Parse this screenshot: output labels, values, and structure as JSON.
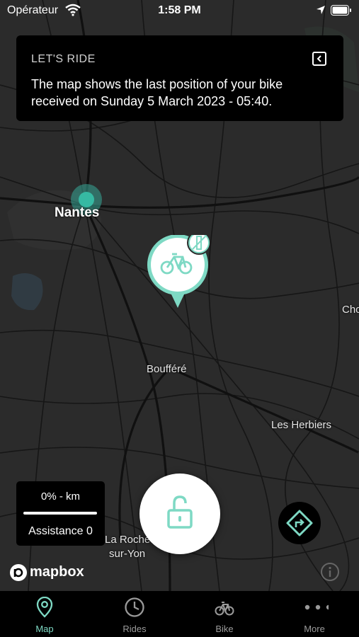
{
  "status_bar": {
    "carrier": "Opérateur",
    "time": "1:58 PM"
  },
  "banner": {
    "title": "LET'S RIDE",
    "message": "The map shows the last position of your bike received on Sunday 5 March 2023 - 05:40."
  },
  "map": {
    "labels": {
      "nantes": "Nantes",
      "bouffere": "Boufféré",
      "les_herbiers": "Les Herbiers",
      "la_roche_line1": "La Roche",
      "la_roche_line2": "sur-Yon",
      "cho": "Cho"
    },
    "attribution": "mapbox"
  },
  "speed_panel": {
    "speed": "0%  - km",
    "assistance": "Assistance 0"
  },
  "tabs": [
    {
      "label": "Map",
      "icon": "map-pin-icon",
      "active": true
    },
    {
      "label": "Rides",
      "icon": "clock-icon",
      "active": false
    },
    {
      "label": "Bike",
      "icon": "bike-icon",
      "active": false
    },
    {
      "label": "More",
      "icon": "more-dots-icon",
      "active": false
    }
  ],
  "colors": {
    "accent": "#7ed9c4",
    "map_bg": "#2b2b2b",
    "road": "#141414",
    "panel": "#000000"
  }
}
